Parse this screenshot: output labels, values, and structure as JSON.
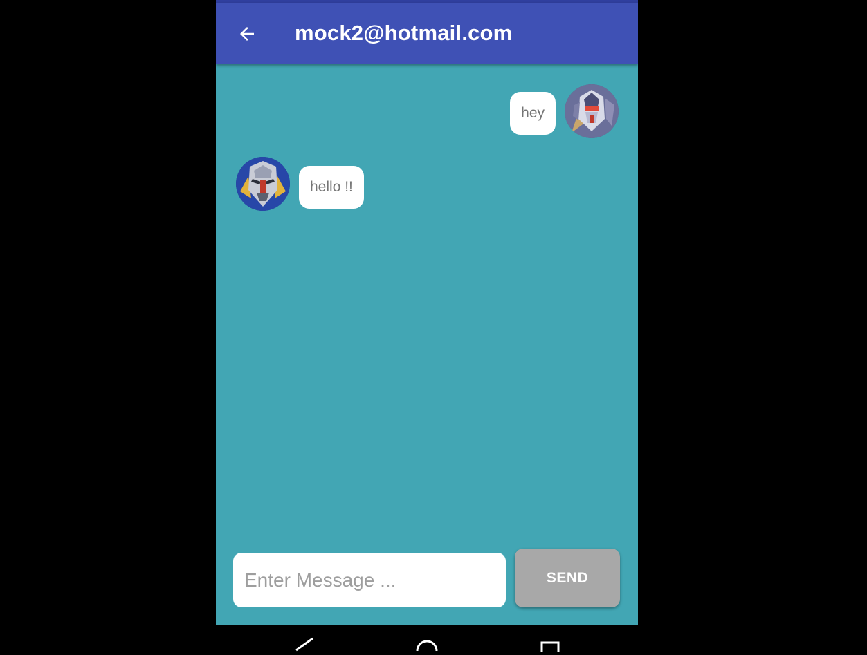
{
  "colors": {
    "appbar": "#3f51b5",
    "chat_background": "#42a6b4",
    "bubble": "#ffffff",
    "bubble_text": "#757575",
    "send_button": "#a8a8a8"
  },
  "header": {
    "back_icon": "arrow-back-icon",
    "title": "mock2@hotmail.com"
  },
  "messages": [
    {
      "side": "right",
      "avatar": "robot-avatar-white-mech",
      "text": "hey"
    },
    {
      "side": "left",
      "avatar": "robot-avatar-blue-mech",
      "text": "hello !!"
    }
  ],
  "composer": {
    "placeholder": "Enter Message ...",
    "value": "",
    "send_label": "SEND"
  },
  "system_nav": {
    "icons": [
      "nav-back-icon",
      "nav-home-icon",
      "nav-recents-icon"
    ]
  }
}
